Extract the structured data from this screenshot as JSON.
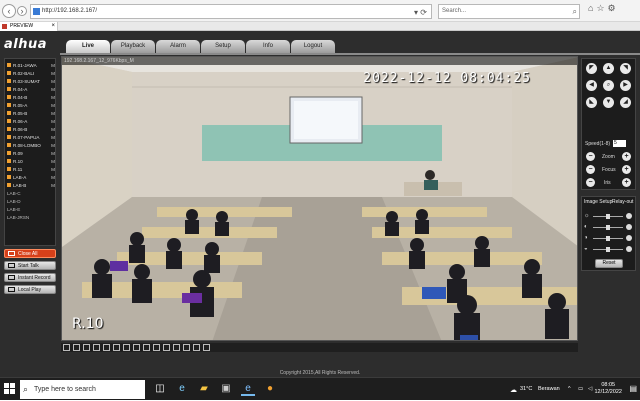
{
  "browser": {
    "url": "http://192.168.2.167/",
    "search_placeholder": "Search...",
    "tab_title": "PREVIEW"
  },
  "app": {
    "logo": "alhua",
    "menu": [
      {
        "label": "Live"
      },
      {
        "label": "Playback"
      },
      {
        "label": "Alarm"
      },
      {
        "label": "Setup"
      },
      {
        "label": "Info"
      },
      {
        "label": "Logout"
      }
    ],
    "channels": [
      {
        "name": "R.01-JAWA",
        "mode": "M"
      },
      {
        "name": "R.02-BALI",
        "mode": "M"
      },
      {
        "name": "R.03-SUMAT",
        "mode": "M"
      },
      {
        "name": "R.04-A",
        "mode": "M"
      },
      {
        "name": "R.04-B",
        "mode": "M"
      },
      {
        "name": "R.05-A",
        "mode": "M"
      },
      {
        "name": "R.05-B",
        "mode": "M"
      },
      {
        "name": "R.06-A",
        "mode": "M"
      },
      {
        "name": "R.06-B",
        "mode": "M"
      },
      {
        "name": "R.07-PAPUA",
        "mode": "M"
      },
      {
        "name": "R.08-LOMBO",
        "mode": "M"
      },
      {
        "name": "R.09",
        "mode": "M"
      },
      {
        "name": "R.10",
        "mode": "M"
      },
      {
        "name": "R.11",
        "mode": "M"
      },
      {
        "name": "LAB-A",
        "mode": "M"
      },
      {
        "name": "LAB-B",
        "mode": "M"
      },
      {
        "name": "LAB-C",
        "mode": ""
      },
      {
        "name": "LAB-D",
        "mode": ""
      },
      {
        "name": "LAB-E",
        "mode": ""
      },
      {
        "name": "LAB-JRSN",
        "mode": ""
      }
    ],
    "controls": {
      "close_all": "Close All",
      "start_talk": "Start Talk",
      "instant_record": "Instant Record",
      "local_play": "Local Play"
    },
    "video": {
      "info": "192.168.2.167_12_976Kbps_M",
      "timestamp": "2022-12-12 08:04:25",
      "camera_label": "R.10"
    },
    "ptz": {
      "speed_label": "Speed(1-8)",
      "speed_value": "5",
      "zoom_label": "Zoom",
      "focus_label": "Focus",
      "iris_label": "Iris"
    },
    "image_setup": {
      "tab_setup": "Image Setup",
      "tab_relay": "Relay-out",
      "reset_label": "Reset",
      "sliders": [
        {
          "icon": "brightness-icon",
          "level": 0.5
        },
        {
          "icon": "contrast-icon",
          "level": 0.5
        },
        {
          "icon": "hue-icon",
          "level": 0.5
        },
        {
          "icon": "saturation-icon",
          "level": 0.5
        }
      ]
    },
    "copyright": "Copyright 2015,All Rights Reserved."
  },
  "taskbar": {
    "search_placeholder": "Type here to search",
    "weather_temp": "31°C",
    "weather_text": "Berawan",
    "time": "08:05",
    "date": "12/12/2022"
  }
}
